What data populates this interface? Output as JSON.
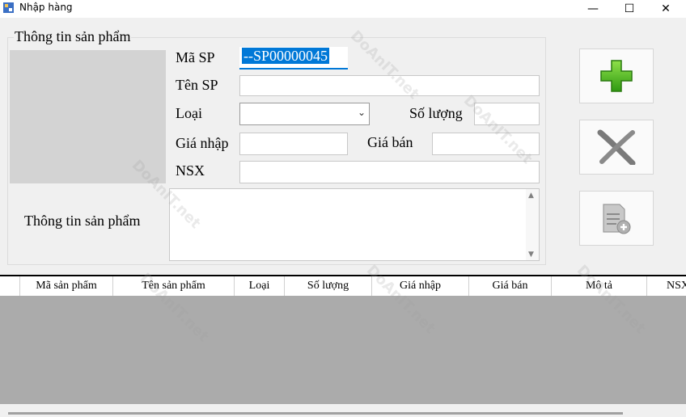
{
  "window": {
    "title": "Nhập hàng",
    "minimize_glyph": "—",
    "maximize_glyph": "☐",
    "close_glyph": "✕"
  },
  "groupbox": {
    "title": "Thông tin sản phẩm"
  },
  "form": {
    "ma_sp_label": "Mã SP",
    "ma_sp_value": "--SP00000045",
    "ten_sp_label": "Tên SP",
    "ten_sp_value": "",
    "loai_label": "Loại",
    "loai_value": "",
    "so_luong_label": "Số lượng",
    "so_luong_value": "",
    "gia_nhap_label": "Giá nhập",
    "gia_nhap_value": "",
    "gia_ban_label": "Giá bán",
    "gia_ban_value": "",
    "nsx_label": "NSX",
    "nsx_value": "",
    "mo_ta_label": "Thông tin sản phẩm",
    "mo_ta_value": ""
  },
  "buttons": {
    "add": "add-icon",
    "delete": "x-icon",
    "edit": "document-add-icon"
  },
  "grid": {
    "columns": [
      "Mã sản phẩm",
      "Tên sản phẩm",
      "Loại",
      "Số lượng",
      "Giá nhập",
      "Giá bán",
      "Mô tả",
      "NSX"
    ]
  },
  "watermark": {
    "text": "DoAnIT.net"
  },
  "colors": {
    "selection": "#0078d7",
    "add_green": "#4caf1f",
    "grid_bg": "#ababab"
  }
}
